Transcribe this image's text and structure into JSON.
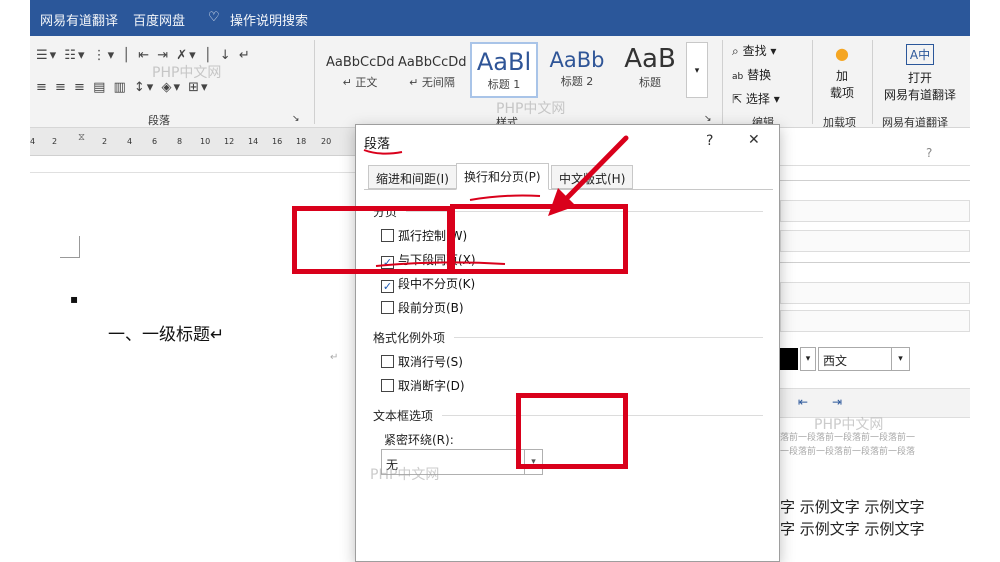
{
  "topbar": {
    "items": [
      "网易有道翻译",
      "百度网盘",
      "操作说明搜索"
    ]
  },
  "ribbon": {
    "paragraph_group": "段落",
    "style_group": "样式",
    "edit_group": "编辑",
    "addin_group": "加载项",
    "translate_group": "网易有道翻译",
    "styles": [
      {
        "preview": "AaBbCcDd",
        "name": "↵ 正文"
      },
      {
        "preview": "AaBbCcDd",
        "name": "↵ 无间隔"
      },
      {
        "preview": "AaBl",
        "name": "标题 1"
      },
      {
        "preview": "AaBb",
        "name": "标题 2"
      },
      {
        "preview": "AaB",
        "name": "标题"
      }
    ],
    "find": "查找",
    "replace": "替换",
    "select": "选择",
    "addin_btn": [
      "加",
      "载项"
    ],
    "open_btn": [
      "打开",
      "网易有道翻译"
    ]
  },
  "ruler": {
    "ticks": [
      "4",
      "2",
      "2",
      "4",
      "6",
      "8",
      "10",
      "12",
      "14",
      "16",
      "18",
      "20"
    ]
  },
  "document": {
    "bullet": "▪",
    "heading": "一、一级标题↵",
    "para_mark": "↵"
  },
  "right_pane": {
    "question": "?",
    "lang_select": "西文",
    "sample_text_gray": [
      "落前一段落前一段落前一段落前一",
      "一段落前一段落前一段落前一段落"
    ],
    "sample_text": [
      "字  示例文字  示例文字",
      "字  示例文字  示例文字"
    ]
  },
  "dialog": {
    "title": "段落",
    "help": "?",
    "close": "✕",
    "tabs": [
      {
        "label": "缩进和间距(I)",
        "active": false
      },
      {
        "label": "换行和分页(P)",
        "active": true
      },
      {
        "label": "中文版式(H)",
        "active": false
      }
    ],
    "pagination_section": "分页",
    "pagination": [
      {
        "label": "孤行控制(W)",
        "checked": false
      },
      {
        "label": "与下段同页(X)",
        "checked": true
      },
      {
        "label": "段中不分页(K)",
        "checked": true
      },
      {
        "label": "段前分页(B)",
        "checked": false
      }
    ],
    "format_section": "格式化例外项",
    "format": [
      {
        "label": "取消行号(S)",
        "checked": false
      },
      {
        "label": "取消断字(D)",
        "checked": false
      }
    ],
    "textbox_section": "文本框选项",
    "tight_wrap_label": "紧密环绕(R):",
    "tight_wrap_value": "无"
  },
  "watermark": "PHP中文网",
  "annotation_color": "#d9001b"
}
